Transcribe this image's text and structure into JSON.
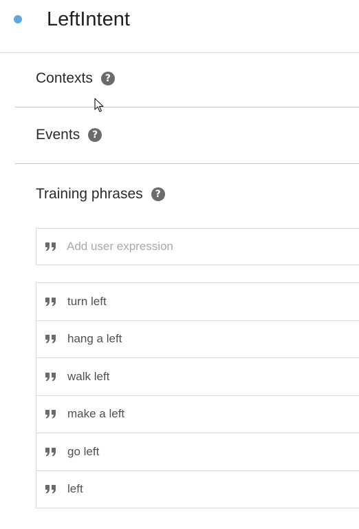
{
  "intent": {
    "title": "LeftIntent",
    "status_color": "#5ba8e0"
  },
  "sections": {
    "contexts": {
      "label": "Contexts",
      "help_icon": "help-circle-icon"
    },
    "events": {
      "label": "Events",
      "help_icon": "help-circle-icon"
    },
    "training_phrases": {
      "label": "Training phrases",
      "help_icon": "help-circle-icon"
    }
  },
  "expression_input": {
    "placeholder": "Add user expression",
    "value": "",
    "icon": "quote-icon"
  },
  "phrases": [
    {
      "text": "turn left"
    },
    {
      "text": "hang a left"
    },
    {
      "text": "walk left"
    },
    {
      "text": "make a left"
    },
    {
      "text": "go left"
    },
    {
      "text": "left"
    }
  ]
}
